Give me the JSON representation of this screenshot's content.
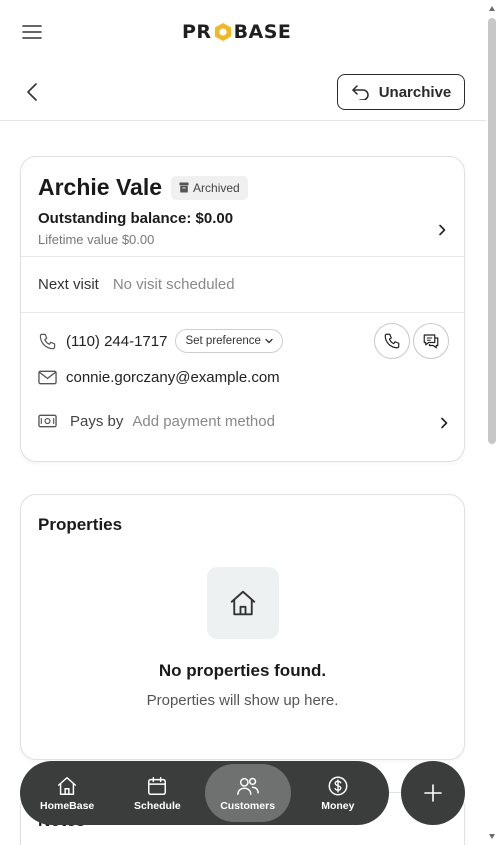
{
  "header": {
    "logo_pre": "PR",
    "logo_post": "BASE"
  },
  "subheader": {
    "unarchive_label": "Unarchive"
  },
  "customer": {
    "name": "Archie Vale",
    "status_badge": "Archived",
    "outstanding_balance": "Outstanding balance: $0.00",
    "lifetime_value": "Lifetime value $0.00",
    "next_visit_label": "Next visit",
    "next_visit_value": "No visit scheduled",
    "phone": "(110) 244-1717",
    "set_preference_label": "Set preference",
    "email": "connie.gorczany@example.com",
    "pays_by_label": "Pays by",
    "payment_method_placeholder": "Add payment method"
  },
  "properties": {
    "title": "Properties",
    "empty_title": "No properties found.",
    "empty_subtitle": "Properties will show up here."
  },
  "notes": {
    "title": "Notes"
  },
  "bottom_nav": {
    "items": [
      {
        "label": "HomeBase",
        "icon": "home-icon"
      },
      {
        "label": "Schedule",
        "icon": "calendar-icon"
      },
      {
        "label": "Customers",
        "icon": "users-icon",
        "active": true
      },
      {
        "label": "Money",
        "icon": "dollar-icon"
      }
    ]
  },
  "colors": {
    "logo_accent": "#f2b824",
    "nav_background": "#3b3d3c",
    "nav_active": "#6e716f"
  }
}
